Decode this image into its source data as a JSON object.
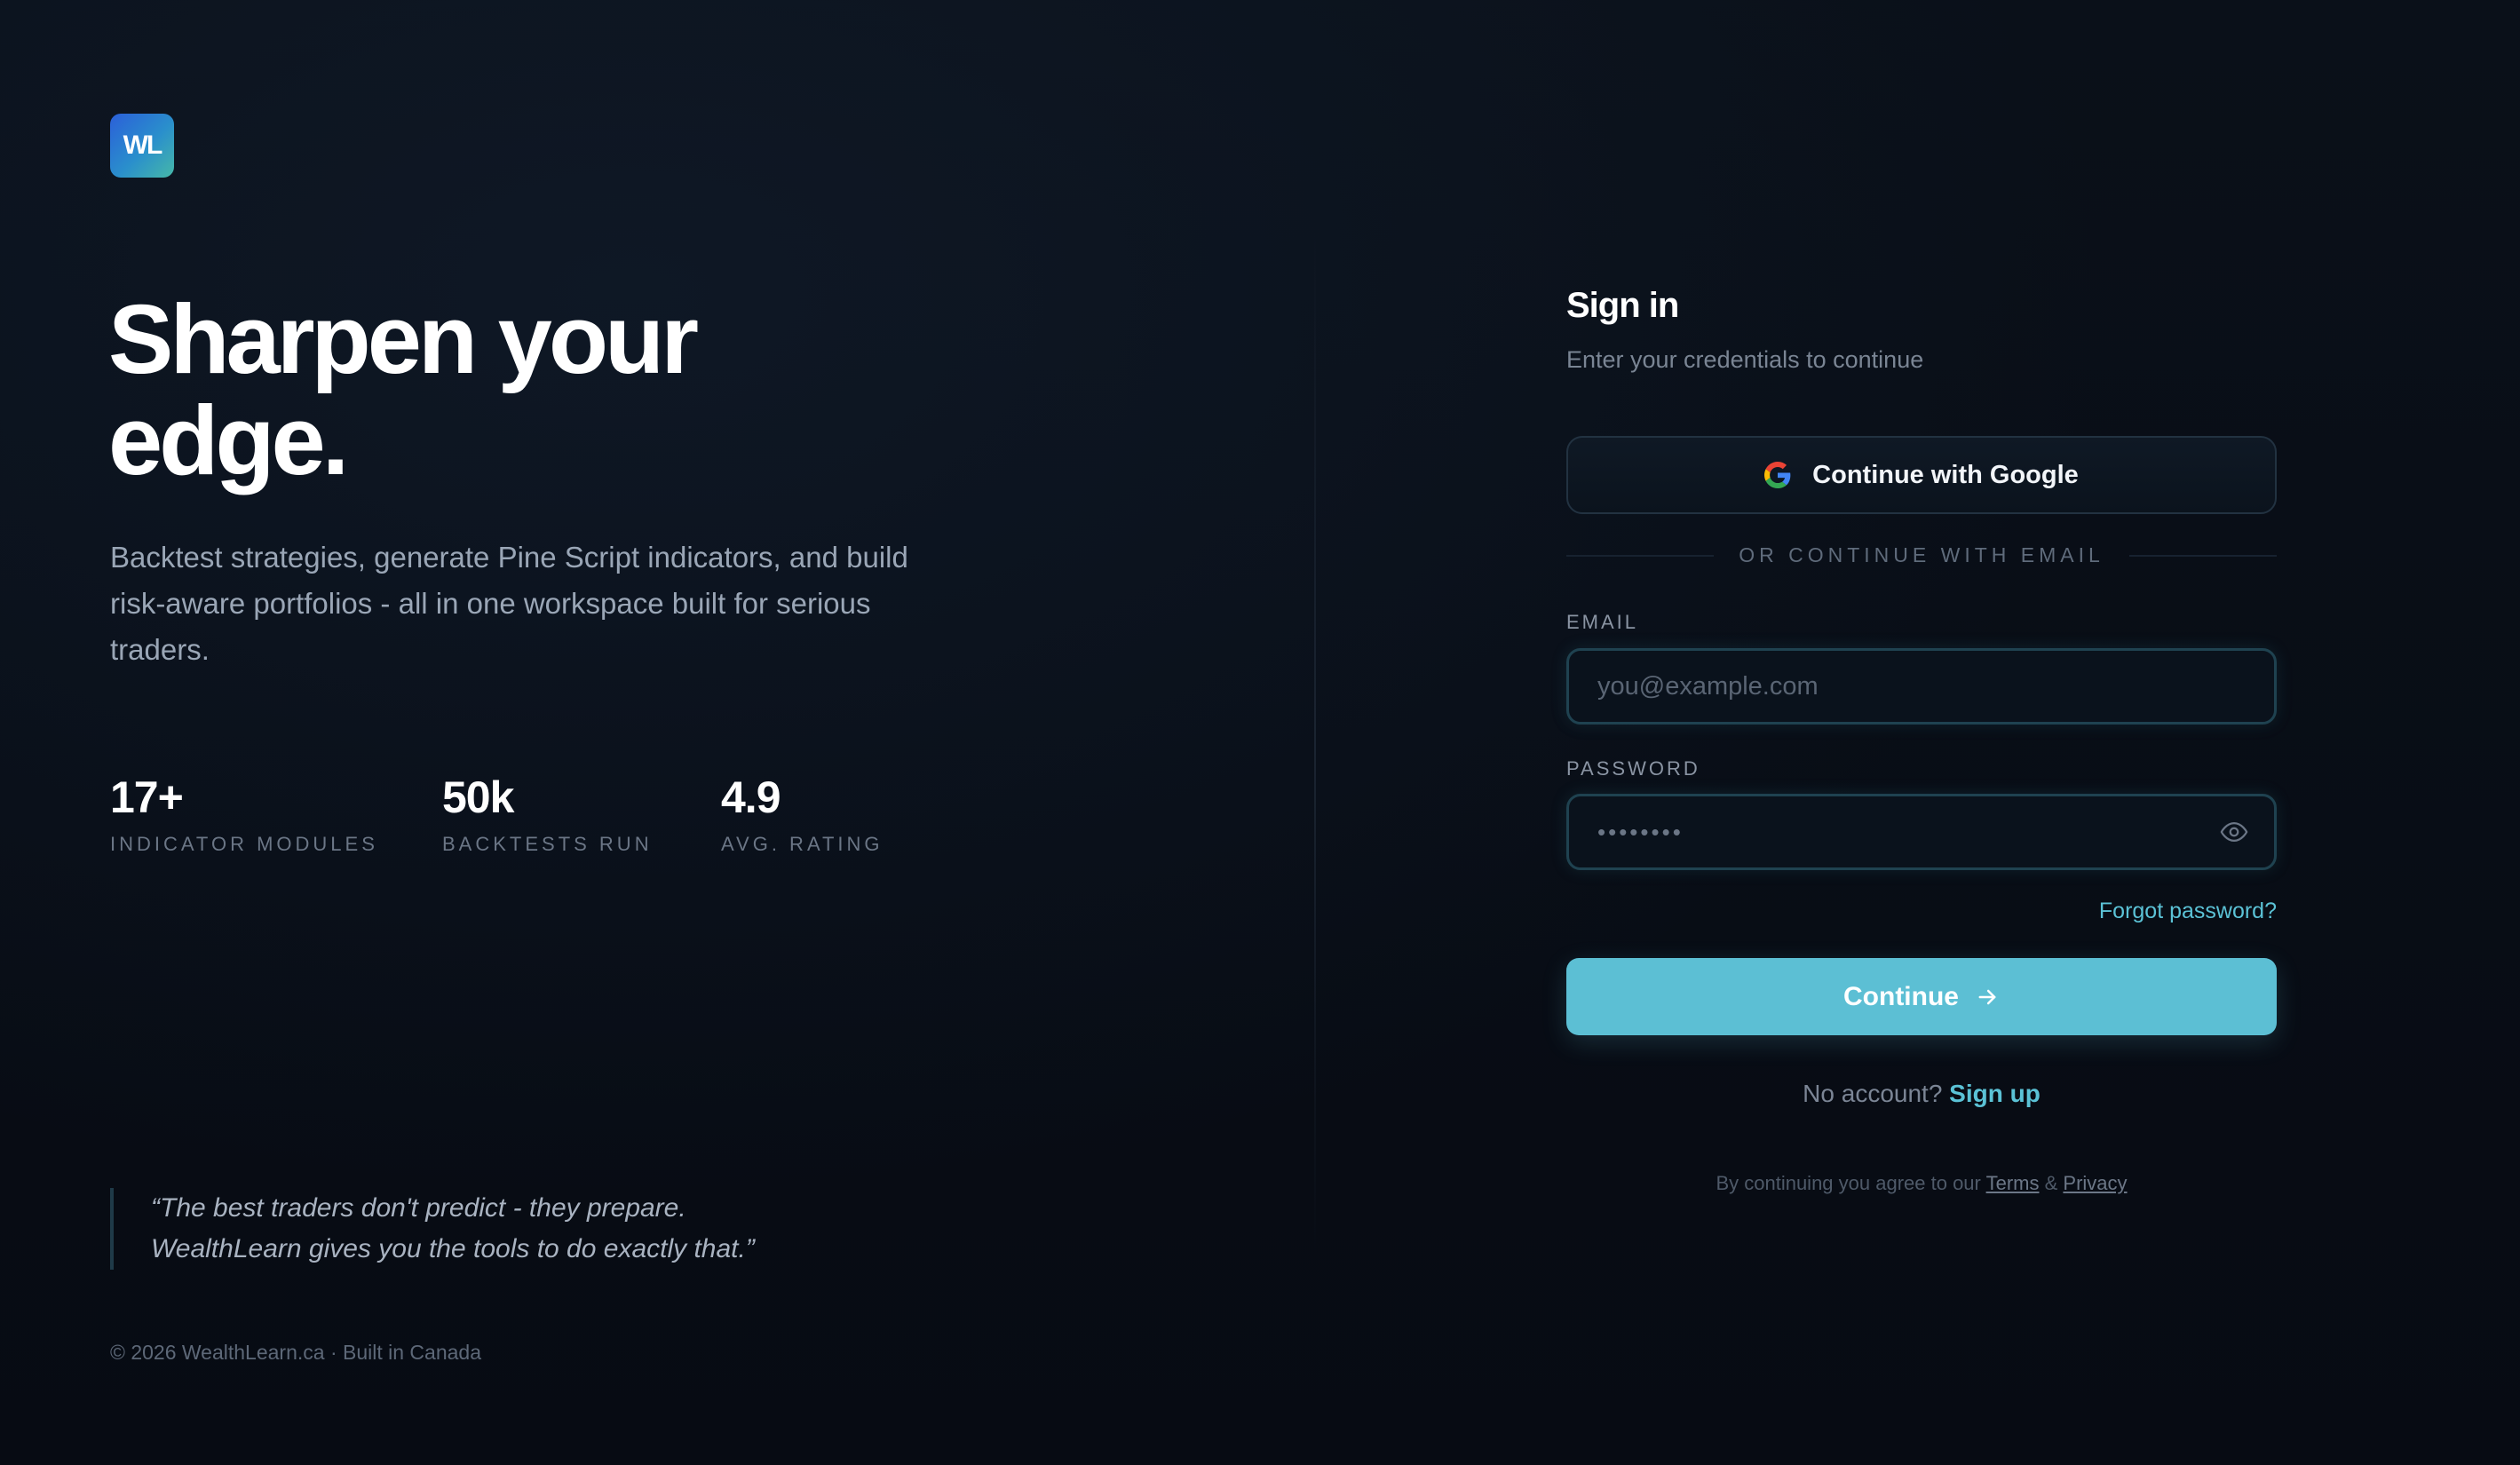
{
  "brand": {
    "logo_text": "WL"
  },
  "hero": {
    "headline_line1": "Sharpen your",
    "headline_line2": "edge.",
    "lede_line1": "Backtest strategies, generate Pine Script indicators, and build",
    "lede_line2": "risk-aware portfolios - all in one workspace built for serious",
    "lede_line3": "traders."
  },
  "stats": [
    {
      "value": "17+",
      "label": "INDICATOR MODULES"
    },
    {
      "value": "50k",
      "label": "BACKTESTS RUN"
    },
    {
      "value": "4.9",
      "label": "AVG. RATING"
    }
  ],
  "quote": {
    "line1": "“The best traders don't predict - they prepare.",
    "line2": "WealthLearn gives you the tools to do exactly that.”"
  },
  "footer": {
    "copyright": "© 2026 WealthLearn.ca · Built in Canada"
  },
  "signin": {
    "title": "Sign in",
    "subtitle": "Enter your credentials to continue",
    "google_button": "Continue with Google",
    "divider_text": "OR CONTINUE WITH EMAIL",
    "email_label": "EMAIL",
    "email_placeholder": "you@example.com",
    "password_label": "PASSWORD",
    "password_masked": "••••••••",
    "forgot_link": "Forgot password?",
    "continue_button": "Continue",
    "no_account_text": "No account?",
    "signup_link": "Sign up",
    "legal_prefix": "By continuing you agree to our",
    "terms_link": "Terms",
    "legal_amp": "&",
    "privacy_link": "Privacy"
  },
  "icons": {
    "google": "google-g-icon",
    "eye": "eye-icon",
    "arrow": "arrow-right-icon"
  },
  "colors": {
    "background": "#070b13",
    "accent": "#5cbfd4",
    "link": "#5bc2d6",
    "logo_gradient_start": "#2b5fd9",
    "logo_gradient_end": "#46b8a8"
  }
}
